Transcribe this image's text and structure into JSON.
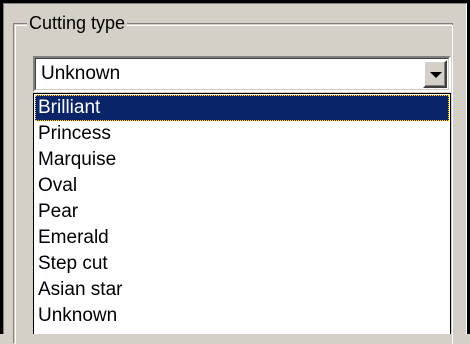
{
  "group": {
    "legend": "Cutting type"
  },
  "combo": {
    "value": "Unknown"
  },
  "dropdown": {
    "options": [
      {
        "label": "Brilliant",
        "selected": true
      },
      {
        "label": "Princess"
      },
      {
        "label": "Marquise"
      },
      {
        "label": "Oval"
      },
      {
        "label": "Pear"
      },
      {
        "label": "Emerald"
      },
      {
        "label": "Step cut"
      },
      {
        "label": "Asian star"
      },
      {
        "label": "Unknown"
      }
    ]
  },
  "colors": {
    "face": "#d4d0c8",
    "highlight": "#0a246a",
    "window": "#ffffff"
  },
  "icons": {
    "dropdown_arrow": "chevron-down-icon"
  }
}
